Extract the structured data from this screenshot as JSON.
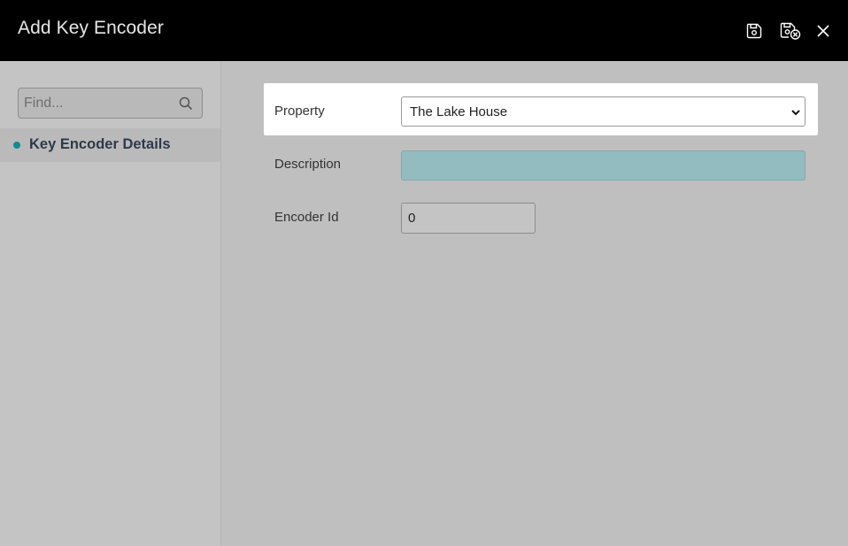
{
  "window": {
    "title": "Add Key Encoder"
  },
  "header_actions": {
    "save_icon": "save-icon",
    "save_close_icon": "save-close-icon",
    "close_icon": "close-icon"
  },
  "sidebar": {
    "find_placeholder": "Find...",
    "items": [
      {
        "label": "Key Encoder Details"
      }
    ]
  },
  "form": {
    "property": {
      "label": "Property",
      "value": "The Lake House"
    },
    "description": {
      "label": "Description",
      "value": ""
    },
    "encoder_id": {
      "label": "Encoder Id",
      "value": "0"
    }
  },
  "colors": {
    "header_bg": "#000000",
    "accent_teal": "#0e8d94",
    "description_field_bg": "#92bcbf",
    "overlay_bg": "#bfbfbf"
  }
}
